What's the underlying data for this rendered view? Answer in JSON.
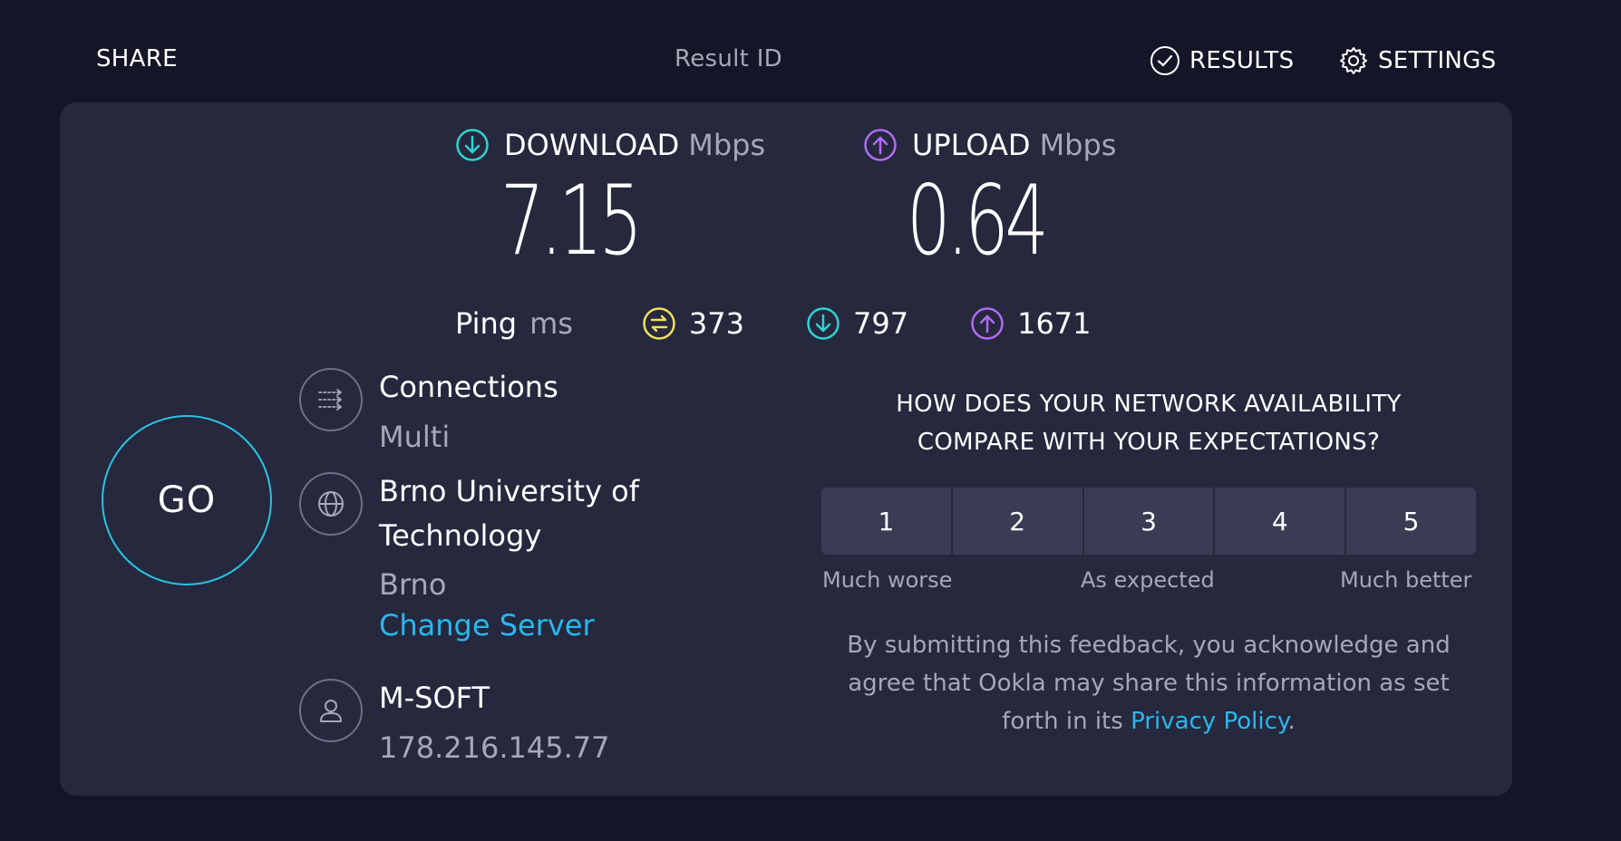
{
  "header": {
    "share_label": "SHARE",
    "result_id_label": "Result ID",
    "results_label": "RESULTS",
    "settings_label": "SETTINGS"
  },
  "download": {
    "label": "DOWNLOAD",
    "unit": "Mbps",
    "value": "7.15",
    "accent": "#2fd4d4"
  },
  "upload": {
    "label": "UPLOAD",
    "unit": "Mbps",
    "value": "0.64",
    "accent": "#b26bf2"
  },
  "ping": {
    "label": "Ping",
    "unit": "ms",
    "idle": "373",
    "download": "797",
    "upload": "1671",
    "idle_color": "#f1e05a"
  },
  "go_label": "GO",
  "connections": {
    "title": "Connections",
    "value": "Multi"
  },
  "server": {
    "name_line1": "Brno University of",
    "name_line2": "Technology",
    "location": "Brno",
    "change_label": "Change Server"
  },
  "provider": {
    "name": "M-SOFT",
    "ip": "178.216.145.77"
  },
  "feedback": {
    "question_line1": "HOW DOES YOUR NETWORK AVAILABILITY",
    "question_line2": "COMPARE WITH YOUR EXPECTATIONS?",
    "ratings": [
      "1",
      "2",
      "3",
      "4",
      "5"
    ],
    "scale_low": "Much worse",
    "scale_mid": "As expected",
    "scale_high": "Much better",
    "disclaimer_line1": "By submitting this feedback, you acknowledge and",
    "disclaimer_line2": "agree that Ookla may share this information as set",
    "disclaimer_line3_prefix": "forth in its ",
    "privacy_link": "Privacy Policy",
    "disclaimer_suffix": "."
  },
  "colors": {
    "background": "#141526",
    "panel": "#26283d",
    "link": "#27b8ee",
    "go_ring": "#27c3e4"
  }
}
